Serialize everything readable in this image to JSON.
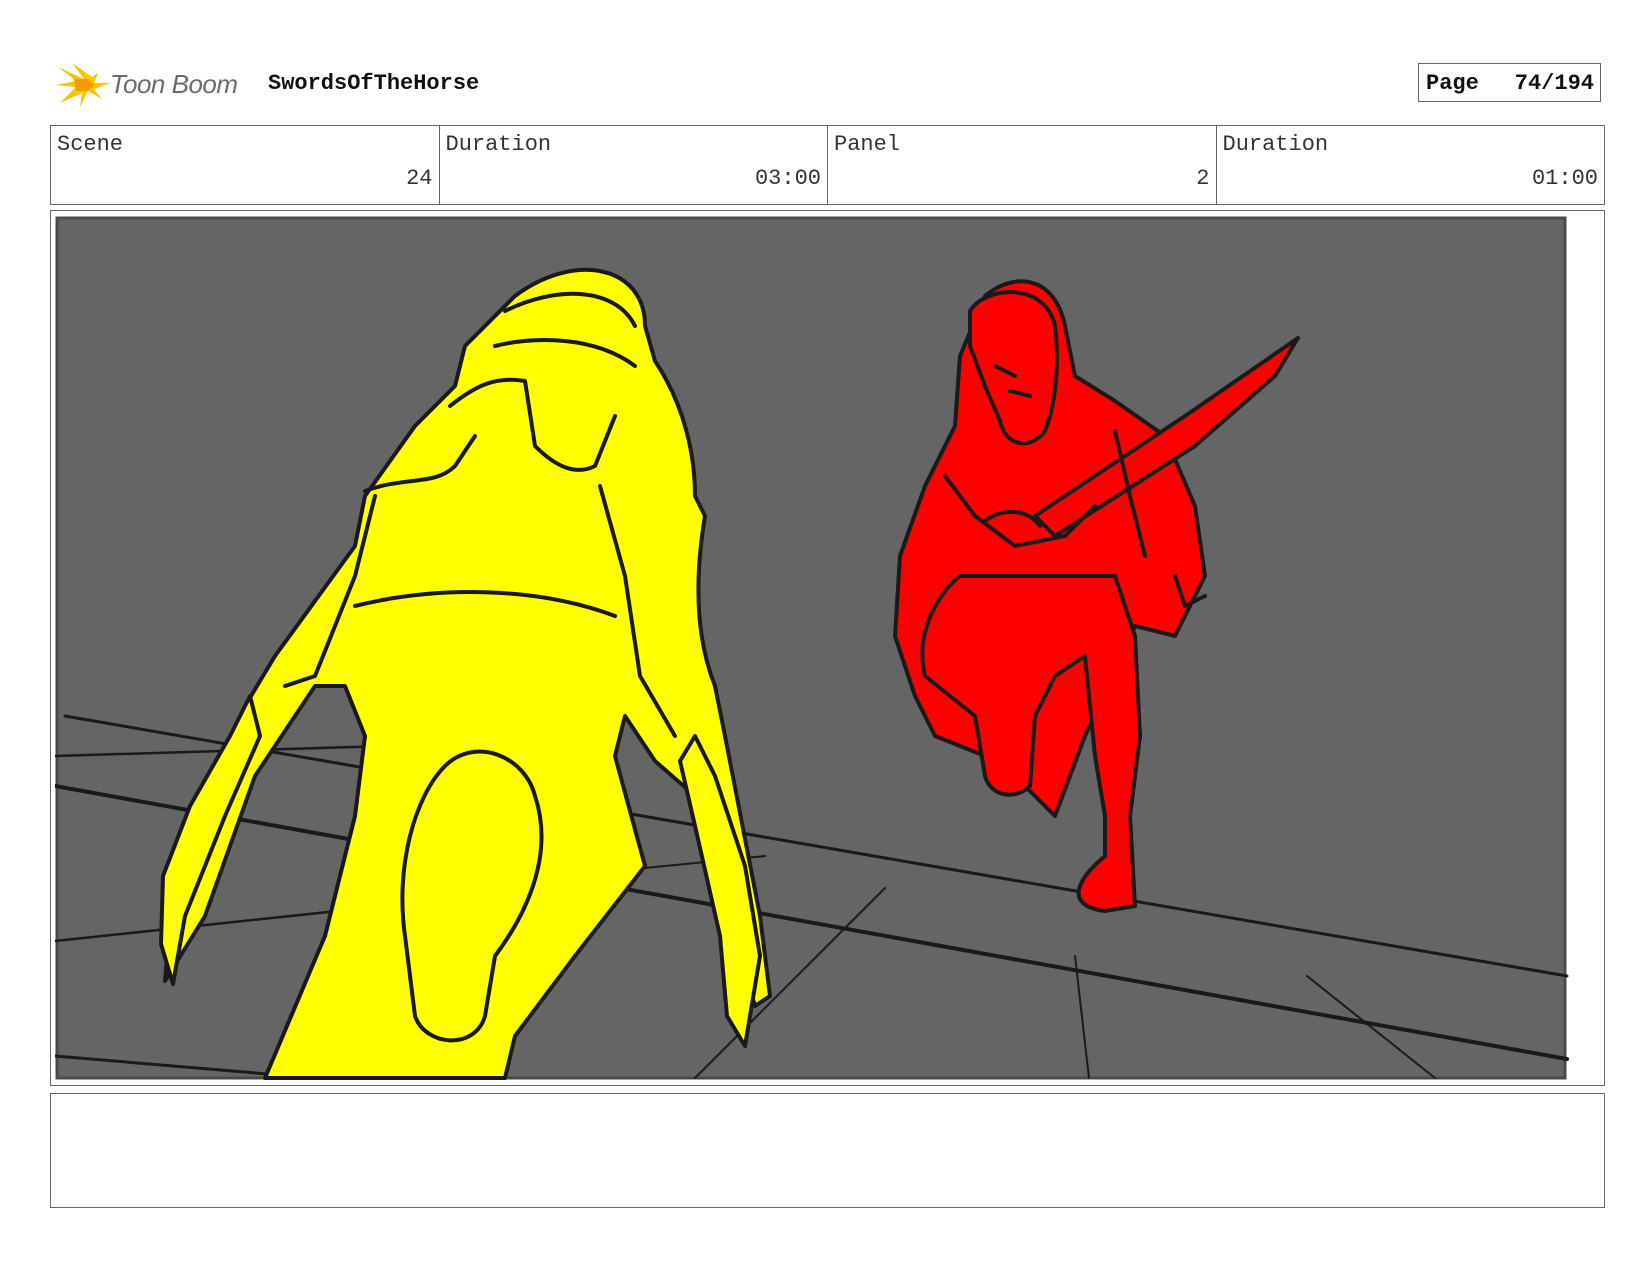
{
  "header": {
    "logo_text": "Toon Boom",
    "project_title": "SwordsOfTheHorse",
    "page_label": "Page",
    "page_value": "74/194"
  },
  "info": {
    "scene_label": "Scene",
    "scene_value": "24",
    "scene_duration_label": "Duration",
    "scene_duration_value": "03:00",
    "panel_label": "Panel",
    "panel_value": "2",
    "panel_duration_label": "Duration",
    "panel_duration_value": "01:00"
  },
  "panel": {
    "background_color": "#656565",
    "yellow_figure_color": "#ffff00",
    "red_figure_color": "#ff0000",
    "line_color": "#1a1a1a"
  },
  "notes": {
    "text": ""
  },
  "colors": {
    "logo_yellow": "#f7c600",
    "logo_orange": "#f39a00",
    "border": "#666666"
  }
}
